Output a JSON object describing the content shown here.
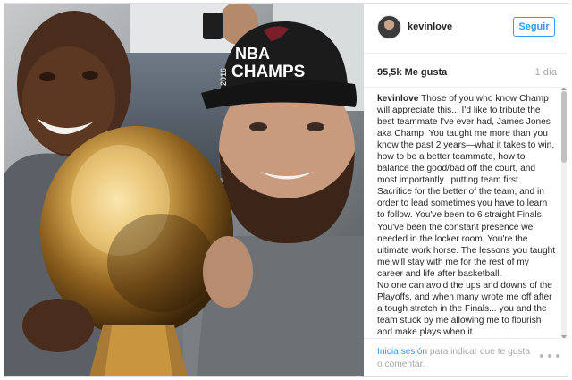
{
  "post": {
    "username": "kevinlove",
    "follow_label": "Seguir",
    "likes": "95,5k Me gusta",
    "time": "1 día",
    "caption_user": "kevinlove",
    "caption_text": " Those of you who know Champ will appreciate this... I'd like to tribute the best teammate I've ever had, James Jones aka Champ. You taught me more than you know the past 2 years—what it takes to win, how to be a better teammate, how to balance the good/bad off the court, and most importantly...putting team first. Sacrifice for the better of the team, and in order to lead sometimes you have to learn to follow. You've been to 6 straight Finals. You've been the constant presence we needed in the locker room. You're the ultimate work horse. The lessons you taught me will stay with me for the rest of my career and life after basketball.\nNo one can avoid the ups and downs of the Playoffs, and when many wrote me off after a tough stretch in the Finals... you and the team stuck by me allowing me to flourish and make plays when it",
    "login_link": "Inicia sesión",
    "login_rest": " para indicar que te gusta o comentar.",
    "more_icon": "ellipsis-icon"
  },
  "photo": {
    "cap_line1": "NBA",
    "cap_line2": "CHAMPS",
    "cap_side": "2016"
  },
  "colors": {
    "accent": "#3897f0",
    "muted": "#a5a7aa",
    "text": "#262626"
  }
}
